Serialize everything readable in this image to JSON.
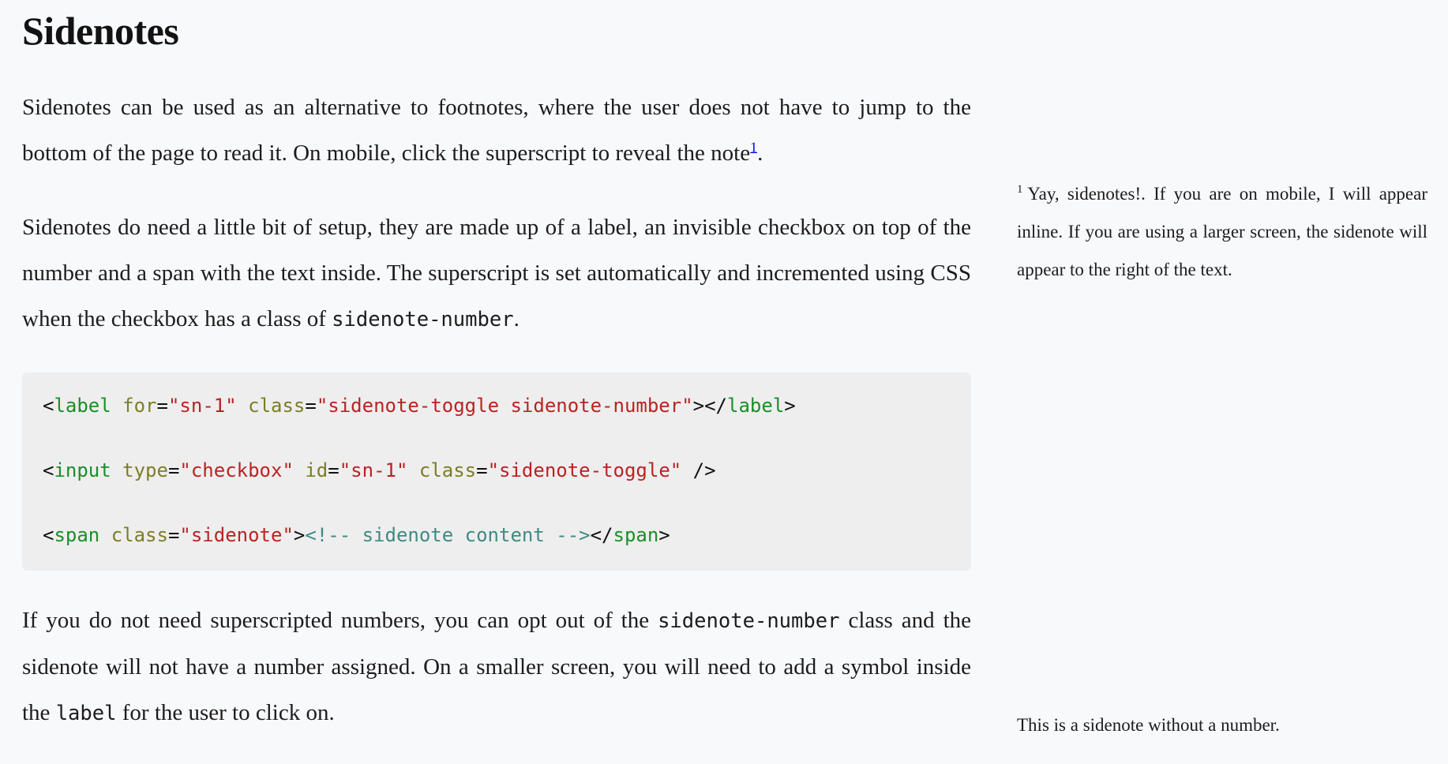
{
  "document": {
    "title": "Sidenotes"
  },
  "paragraphs": {
    "p1_part_a": "Sidenotes can be used as an alternative to footnotes, where the user does not have to jump to the bottom of the page to read it. On mobile, click the superscript to reveal the note",
    "p1_superscript": "1",
    "p1_part_b": ".",
    "p2_part_a": "Sidenotes do need a little bit of setup, they are made up of a label, an invisible checkbox on top of the number and a span with the text inside. The superscript is set automatically and incremented using CSS when the checkbox has a class of ",
    "p2_code": "sidenote-number",
    "p2_part_b": ".",
    "p3_part_a": "If you do not need superscripted numbers, you can opt out of the ",
    "p3_code_1": "sidenote-number",
    "p3_part_b": " class and the sidenote will not have a number assigned. On a smaller screen, you will need to add a symbol inside the ",
    "p3_code_2": "label",
    "p3_part_c": " for the user to click on."
  },
  "code_block": {
    "language": "html",
    "lines": [
      {
        "tokens": [
          {
            "text": "<",
            "type": "punct"
          },
          {
            "text": "label",
            "type": "tag"
          },
          {
            "text": " ",
            "type": "punct"
          },
          {
            "text": "for",
            "type": "attr"
          },
          {
            "text": "=",
            "type": "punct"
          },
          {
            "text": "\"sn-1\"",
            "type": "str"
          },
          {
            "text": " ",
            "type": "punct"
          },
          {
            "text": "class",
            "type": "attr"
          },
          {
            "text": "=",
            "type": "punct"
          },
          {
            "text": "\"sidenote-toggle sidenote-number\"",
            "type": "str"
          },
          {
            "text": "></",
            "type": "punct"
          },
          {
            "text": "label",
            "type": "tag"
          },
          {
            "text": ">",
            "type": "punct"
          }
        ]
      },
      {
        "tokens": [
          {
            "text": "<",
            "type": "punct"
          },
          {
            "text": "input",
            "type": "tag"
          },
          {
            "text": " ",
            "type": "punct"
          },
          {
            "text": "type",
            "type": "attr"
          },
          {
            "text": "=",
            "type": "punct"
          },
          {
            "text": "\"checkbox\"",
            "type": "str"
          },
          {
            "text": " ",
            "type": "punct"
          },
          {
            "text": "id",
            "type": "attr"
          },
          {
            "text": "=",
            "type": "punct"
          },
          {
            "text": "\"sn-1\"",
            "type": "str"
          },
          {
            "text": " ",
            "type": "punct"
          },
          {
            "text": "class",
            "type": "attr"
          },
          {
            "text": "=",
            "type": "punct"
          },
          {
            "text": "\"sidenote-toggle\"",
            "type": "str"
          },
          {
            "text": " />",
            "type": "punct"
          }
        ]
      },
      {
        "tokens": [
          {
            "text": "<",
            "type": "punct"
          },
          {
            "text": "span",
            "type": "tag"
          },
          {
            "text": " ",
            "type": "punct"
          },
          {
            "text": "class",
            "type": "attr"
          },
          {
            "text": "=",
            "type": "punct"
          },
          {
            "text": "\"sidenote\"",
            "type": "str"
          },
          {
            "text": ">",
            "type": "punct"
          },
          {
            "text": "<!-- sidenote content -->",
            "type": "comment"
          },
          {
            "text": "</",
            "type": "punct"
          },
          {
            "text": "span",
            "type": "tag"
          },
          {
            "text": ">",
            "type": "punct"
          }
        ]
      }
    ]
  },
  "sidenotes": [
    {
      "number": "1",
      "text": "Yay, sidenotes!. If you are on mobile, I will appear inline. If you are using a larger screen, the sidenote will appear to the right of the text."
    },
    {
      "number": "",
      "text": "This is a sidenote without a number."
    }
  ],
  "colors": {
    "page_background": "#f8f9fb",
    "code_background": "#eeeeee",
    "text": "#1c1c1c",
    "tag": "#1a8f27",
    "attribute": "#7d7d26",
    "string": "#bb2222",
    "comment": "#3f8a82"
  }
}
